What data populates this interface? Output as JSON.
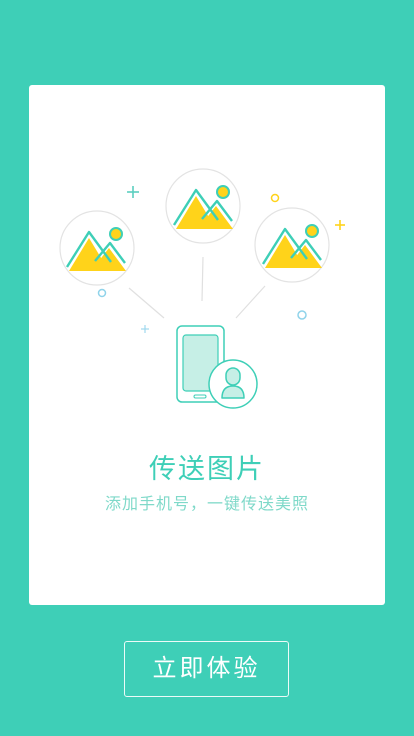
{
  "colors": {
    "background": "#3ecfb7",
    "card": "#ffffff",
    "accent": "#3ecfb7",
    "subtext": "#7fd9c9",
    "sun_yellow": "#ffd31a"
  },
  "icons": [
    "image-bubble-icon",
    "phone-icon",
    "contact-icon",
    "sparkle-plus-icon",
    "ring-dot-icon"
  ],
  "card": {
    "title": "传送图片",
    "subtitle": "添加手机号，一键传送美照"
  },
  "cta": {
    "label": "立即体验"
  }
}
